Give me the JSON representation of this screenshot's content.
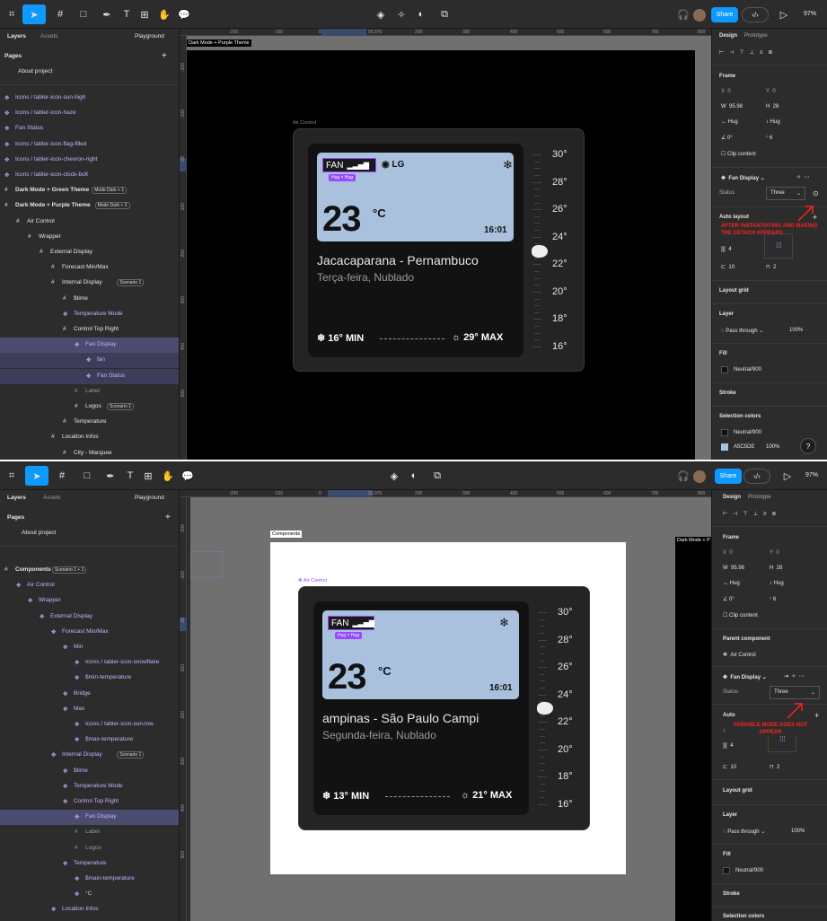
{
  "s1": {
    "toolbar": {
      "share_label": "Share",
      "zoom": "97%"
    },
    "left": {
      "tabs": [
        "Layers",
        "Assets"
      ],
      "playground": "Playground",
      "pages_label": "Pages",
      "page": "About project",
      "layers": [
        {
          "label": "Icons / tabler-icon-sun-high",
          "style": "purple",
          "indent": 0
        },
        {
          "label": "Icons / tabler-icon-haze",
          "style": "purple",
          "indent": 0
        },
        {
          "label": "Fan Status",
          "style": "purple",
          "indent": 0
        },
        {
          "label": "Icons / tabler-icon-flag-filled",
          "style": "purple",
          "indent": 0
        },
        {
          "label": "Icons / tabler-icon-chevron-right",
          "style": "purple",
          "indent": 0
        },
        {
          "label": "Icons / tabler-icon-clock-bolt",
          "style": "purple",
          "indent": 0
        },
        {
          "label": "Dark Mode + Green Theme",
          "style": "bold",
          "indent": 0,
          "badge": "Mode Dark + 1"
        },
        {
          "label": "Dark Mode + Purple Theme",
          "style": "bold",
          "indent": 0,
          "badge": "Mode Dark + 2"
        },
        {
          "label": "Air Control",
          "style": "",
          "indent": 1
        },
        {
          "label": "Wrapper",
          "style": "",
          "indent": 2
        },
        {
          "label": "External Display",
          "style": "",
          "indent": 3
        },
        {
          "label": "Forecast Min/Max",
          "style": "",
          "indent": 4
        },
        {
          "label": "Internal Display",
          "style": "",
          "indent": 4,
          "badge": "Scenario 1"
        },
        {
          "label": "$time",
          "style": "",
          "indent": 5
        },
        {
          "label": "Temperature Mode",
          "style": "purple",
          "indent": 5
        },
        {
          "label": "Control Top Right",
          "style": "",
          "indent": 5
        },
        {
          "label": "Fan Display",
          "style": "purple",
          "indent": 6,
          "sel": "sel"
        },
        {
          "label": "fan",
          "style": "purple",
          "indent": 7,
          "sel": "sel2"
        },
        {
          "label": "Fan Status",
          "style": "purple",
          "indent": 7,
          "sel": "sel2"
        },
        {
          "label": "Label",
          "style": "dim",
          "indent": 6
        },
        {
          "label": "Logos",
          "style": "",
          "indent": 6,
          "badge": "Scenario 1"
        },
        {
          "label": "Temperature",
          "style": "",
          "indent": 5
        },
        {
          "label": "Location Infos",
          "style": "",
          "indent": 4
        },
        {
          "label": "City - Marquee",
          "style": "",
          "indent": 5
        }
      ]
    },
    "ruler": {
      "ticks": [
        "-200",
        "-100",
        "0",
        "95.976",
        "200",
        "300",
        "400",
        "500",
        "600",
        "700",
        "800"
      ],
      "v": [
        "-200",
        "-100",
        "28",
        "100",
        "200",
        "300",
        "400",
        "500"
      ]
    },
    "canvas": {
      "frame_label": "Dark Mode + Purple Theme",
      "component_label": "Air Control"
    },
    "device": {
      "fan": "FAN",
      "logo": "LG",
      "hug": "Hug × Hug",
      "temp": "23",
      "unit": "°C",
      "time": "16:01",
      "city": "Jacacaparana - Pernambuco",
      "day": "Terça-feira, Nublado",
      "min": "16° MIN",
      "max": "29° MAX",
      "scale": [
        "30°",
        "28°",
        "26°",
        "24°",
        "22°",
        "20°",
        "18°",
        "16°"
      ]
    },
    "right": {
      "tabs": [
        "Design",
        "Prototype"
      ],
      "frame": "Frame",
      "x": "0",
      "y": "0",
      "w": "95.98",
      "h": "28",
      "hug_w": "Hug",
      "hug_h": "Hug",
      "rot": "0°",
      "radius": "6",
      "clip": "Clip content",
      "component": "Fan Display",
      "status_label": "Status",
      "status_value": "Three",
      "autolayout": "Auto layout",
      "gap": "4",
      "pad": "10",
      "pad2": "2",
      "layout_grid": "Layout grid",
      "layer": "Layer",
      "blend": "Pass through",
      "opacity": "100%",
      "fill": "Fill",
      "fill_name": "Neutral/900",
      "stroke": "Stroke",
      "sel_colors": "Selection colors",
      "sel1": "Neutral/900",
      "sel2": "A5C5DE",
      "sel2_op": "100%"
    },
    "annotation": "AFTER INSTANTIATING AND MAKING THE DETACH APPEARS"
  },
  "s2": {
    "toolbar": {
      "share_label": "Share",
      "zoom": "97%"
    },
    "left": {
      "tabs": [
        "Layers",
        "Assets"
      ],
      "playground": "Playground",
      "pages_label": "Pages",
      "page": "About project",
      "layers": [
        {
          "label": "Components",
          "style": "bold",
          "indent": 0,
          "badge": "Scenario 1 + 1"
        },
        {
          "label": "Air Control",
          "style": "purple",
          "indent": 1
        },
        {
          "label": "Wrapper",
          "style": "purple",
          "indent": 2
        },
        {
          "label": "External Display",
          "style": "purple",
          "indent": 3
        },
        {
          "label": "Forecast Min/Max",
          "style": "purple",
          "indent": 4
        },
        {
          "label": "Min",
          "style": "purple",
          "indent": 5
        },
        {
          "label": "Icons / tabler-icon-snowflake",
          "style": "purple",
          "indent": 6
        },
        {
          "label": "$min-temperature",
          "style": "purple",
          "indent": 6
        },
        {
          "label": "Bridge",
          "style": "purple",
          "indent": 5
        },
        {
          "label": "Max",
          "style": "purple",
          "indent": 5
        },
        {
          "label": "Icons / tabler-icon-sun-low",
          "style": "purple",
          "indent": 6
        },
        {
          "label": "$max-temperature",
          "style": "purple",
          "indent": 6
        },
        {
          "label": "Internal Display",
          "style": "purple",
          "indent": 4,
          "badge": "Scenario 1"
        },
        {
          "label": "$time",
          "style": "purple",
          "indent": 5
        },
        {
          "label": "Temperature Mode",
          "style": "purple",
          "indent": 5
        },
        {
          "label": "Control Top Right",
          "style": "purple",
          "indent": 5
        },
        {
          "label": "Fan Display",
          "style": "purple",
          "indent": 6,
          "sel": "sel"
        },
        {
          "label": "Label",
          "style": "dim",
          "indent": 6
        },
        {
          "label": "Logos",
          "style": "dim",
          "indent": 6
        },
        {
          "label": "Temperature",
          "style": "purple",
          "indent": 5
        },
        {
          "label": "$main-temperature",
          "style": "purple",
          "indent": 6
        },
        {
          "label": "°C",
          "style": "purple",
          "indent": 6
        },
        {
          "label": "Location Infos",
          "style": "purple",
          "indent": 4
        },
        {
          "label": "City - Marquee",
          "style": "purple",
          "indent": 5
        }
      ]
    },
    "ruler": {
      "ticks": [
        "-200",
        "-100",
        "0",
        "95.976",
        "200",
        "300",
        "400",
        "500",
        "600",
        "700",
        "800"
      ],
      "v": [
        "-200",
        "-100",
        "28",
        "100",
        "200",
        "300",
        "400",
        "500"
      ]
    },
    "canvas": {
      "frame_label": "Components",
      "component_label": "Air Control",
      "side_label": "Dark Mode + P"
    },
    "device": {
      "fan": "FAN",
      "hug": "Hug × Hug",
      "temp": "23",
      "unit": "°C",
      "time": "16:01",
      "city": "ampinas - São Paulo  Campi",
      "day": "Segunda-feira, Nublado",
      "min": "13° MIN",
      "max": "21° MAX",
      "scale": [
        "30°",
        "28°",
        "26°",
        "24°",
        "22°",
        "20°",
        "18°",
        "16°"
      ]
    },
    "right": {
      "tabs": [
        "Design",
        "Prototype"
      ],
      "frame": "Frame",
      "x": "0",
      "y": "0",
      "w": "95.98",
      "h": "28",
      "hug_w": "Hug",
      "hug_h": "Hug",
      "rot": "0°",
      "radius": "6",
      "clip": "Clip content",
      "parent": "Parent component",
      "parent_name": "Air Control",
      "component": "Fan Display",
      "status_label": "Status",
      "status_value": "Three",
      "autolayout": "Auto",
      "gap": "4",
      "pad": "10",
      "pad2": "2",
      "layout_grid": "Layout grid",
      "layer": "Layer",
      "blend": "Pass through",
      "opacity": "100%",
      "fill": "Fill",
      "fill_name": "Neutral/900",
      "stroke": "Stroke",
      "sel_colors": "Selection colors"
    },
    "annotation": "VARIABLE MODE DOES NOT APPEAR"
  }
}
